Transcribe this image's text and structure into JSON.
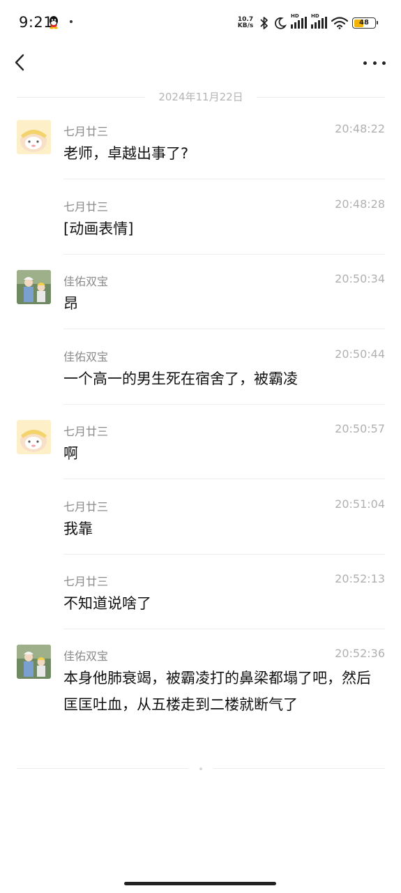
{
  "status_bar": {
    "time": "9:21",
    "net_speed_value": "10.7",
    "net_speed_unit": "KB/s",
    "hd_label": "HD",
    "battery": "48",
    "battery_level": 0.48,
    "icons": [
      "qq-icon",
      "bluetooth-icon",
      "moon-icon",
      "signal-icon",
      "signal-icon",
      "wifi-icon",
      "battery-icon"
    ]
  },
  "header": {
    "back_icon": "chevron-left-icon",
    "more_icon": "more-dots-icon"
  },
  "date_divider": "2024年11月22日",
  "messages": [
    {
      "sender": "七月廿三",
      "time": "20:48:22",
      "text": "老师，卓越出事了?",
      "avatar": "cartoon-avatar"
    },
    {
      "sender": "七月廿三",
      "time": "20:48:28",
      "text": "[动画表情]",
      "avatar": ""
    },
    {
      "sender": "佳佑双宝",
      "time": "20:50:34",
      "text": "昂",
      "avatar": "kids-photo-avatar"
    },
    {
      "sender": "佳佑双宝",
      "time": "20:50:44",
      "text": "一个高一的男生死在宿舍了，被霸凌",
      "avatar": ""
    },
    {
      "sender": "七月廿三",
      "time": "20:50:57",
      "text": "啊",
      "avatar": "cartoon-avatar"
    },
    {
      "sender": "七月廿三",
      "time": "20:51:04",
      "text": "我靠",
      "avatar": ""
    },
    {
      "sender": "七月廿三",
      "time": "20:52:13",
      "text": "不知道说啥了",
      "avatar": ""
    },
    {
      "sender": "佳佑双宝",
      "time": "20:52:36",
      "text": "本身他肺衰竭，被霸凌打的鼻梁都塌了吧，然后匡匡吐血，从五楼走到二楼就断气了",
      "avatar": "kids-photo-avatar"
    }
  ]
}
